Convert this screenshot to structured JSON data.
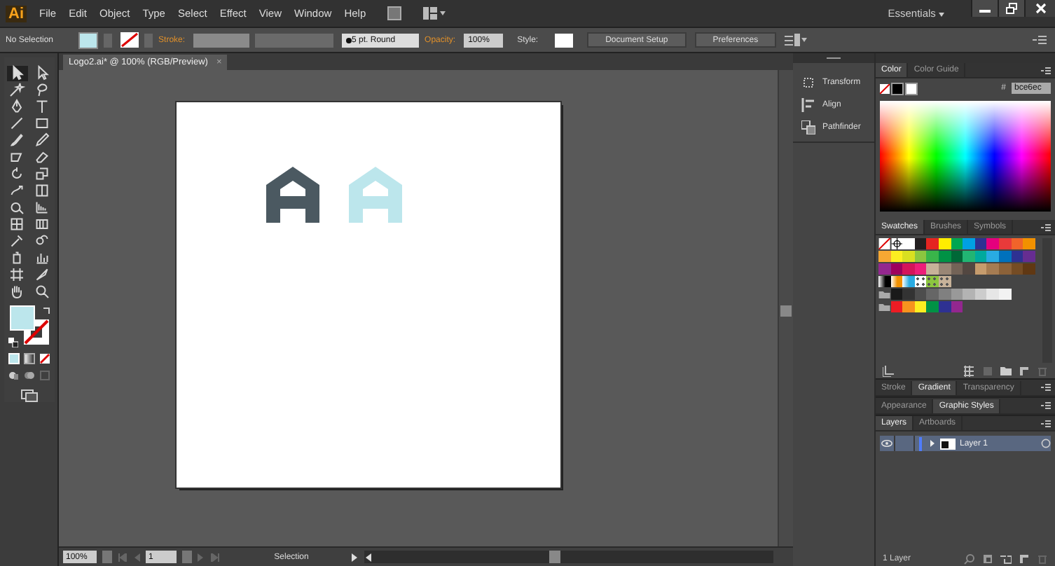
{
  "menu_bar": {
    "logo": "Ai",
    "items": [
      "File",
      "Edit",
      "Object",
      "Type",
      "Select",
      "Effect",
      "View",
      "Window",
      "Help"
    ],
    "workspace": "Essentials"
  },
  "current_colors": {
    "fill": {
      "color": "#bce6ec"
    },
    "stroke": {
      "none": true
    }
  },
  "control_bar": {
    "selection": "No Selection",
    "stroke_label": "Stroke:",
    "brush": "5 pt. Round",
    "opacity_label": "Opacity:",
    "opacity": "100%",
    "style_label": "Style:",
    "buttons": [
      "Document Setup",
      "Preferences"
    ]
  },
  "document_tab": {
    "title": "Logo2.ai* @ 100% (RGB/Preview)",
    "close": "×"
  },
  "tools": [
    {
      "kind": "arrow",
      "selected": true
    },
    {
      "kind": "hollow-arrow",
      "selected": false
    },
    {
      "kind": "wand",
      "selected": false
    },
    {
      "kind": "lasso",
      "selected": false
    },
    {
      "kind": "pen",
      "selected": false
    },
    {
      "kind": "type",
      "selected": false
    },
    {
      "kind": "line",
      "selected": false
    },
    {
      "kind": "rectangle",
      "selected": false
    },
    {
      "kind": "brush",
      "selected": false
    },
    {
      "kind": "pencil",
      "selected": false
    },
    {
      "kind": "blob-brush",
      "selected": false
    },
    {
      "kind": "eraser",
      "selected": false
    },
    {
      "kind": "rotate",
      "selected": false
    },
    {
      "kind": "scale",
      "selected": false
    },
    {
      "kind": "warp",
      "selected": false
    },
    {
      "kind": "free-transform",
      "selected": false
    },
    {
      "kind": "shape-builder",
      "selected": false
    },
    {
      "kind": "perspective-grid",
      "selected": false
    },
    {
      "kind": "mesh",
      "selected": false
    },
    {
      "kind": "gradient",
      "selected": false
    },
    {
      "kind": "eyedropper",
      "selected": false
    },
    {
      "kind": "blend",
      "selected": false
    },
    {
      "kind": "spray-can",
      "selected": false
    },
    {
      "kind": "bar-graph",
      "selected": false
    },
    {
      "kind": "artboard",
      "selected": false
    },
    {
      "kind": "knife",
      "selected": false
    },
    {
      "kind": "hand",
      "selected": false
    },
    {
      "kind": "zoom",
      "selected": false
    }
  ],
  "artwork": [
    {
      "color": "#4b5961"
    },
    {
      "color": "#bce6ec"
    }
  ],
  "status_bar": {
    "zoom": "100%",
    "page": "1",
    "tool": "Selection"
  },
  "side_panels": [
    "Transform",
    "Align",
    "Pathfinder"
  ],
  "color_panel": {
    "tabs": [
      {
        "label": "Color",
        "selected": true
      },
      {
        "label": "Color Guide",
        "selected": false
      }
    ],
    "hash": "#",
    "hex": "bce6ec"
  },
  "swatches_panel": {
    "tabs": [
      {
        "label": "Swatches",
        "selected": true
      },
      {
        "label": "Brushes",
        "selected": false
      },
      {
        "label": "Symbols",
        "selected": false
      }
    ],
    "rows": [
      [
        {
          "kind": "none"
        },
        {
          "kind": "registration"
        },
        {
          "kind": "color",
          "color": "#ffffff"
        },
        {
          "kind": "color",
          "color": "#231f20"
        },
        {
          "kind": "color",
          "color": "#e52421"
        },
        {
          "kind": "color",
          "color": "#ffed00"
        },
        {
          "kind": "color",
          "color": "#00a651"
        },
        {
          "kind": "color",
          "color": "#00a0e3"
        },
        {
          "kind": "color",
          "color": "#2e3192"
        },
        {
          "kind": "color",
          "color": "#e5007d"
        },
        {
          "kind": "color",
          "color": "#e83a3a"
        },
        {
          "kind": "color",
          "color": "#f0642a"
        },
        {
          "kind": "color",
          "color": "#f29100"
        }
      ],
      [
        {
          "kind": "color",
          "color": "#f7a833"
        },
        {
          "kind": "color",
          "color": "#fcee21"
        },
        {
          "kind": "color",
          "color": "#d9e021"
        },
        {
          "kind": "color",
          "color": "#8cc63f"
        },
        {
          "kind": "color",
          "color": "#39b54a"
        },
        {
          "kind": "color",
          "color": "#009245"
        },
        {
          "kind": "color",
          "color": "#006837"
        },
        {
          "kind": "color",
          "color": "#22b573"
        },
        {
          "kind": "color",
          "color": "#00a99d"
        },
        {
          "kind": "color",
          "color": "#29abe2"
        },
        {
          "kind": "color",
          "color": "#0071bc"
        },
        {
          "kind": "color",
          "color": "#2e3192"
        },
        {
          "kind": "color",
          "color": "#662d91"
        }
      ],
      [
        {
          "kind": "color",
          "color": "#93278f"
        },
        {
          "kind": "color",
          "color": "#9e005d"
        },
        {
          "kind": "color",
          "color": "#d4145a"
        },
        {
          "kind": "color",
          "color": "#ed1e79"
        },
        {
          "kind": "color",
          "color": "#c7b299"
        },
        {
          "kind": "color",
          "color": "#998675"
        },
        {
          "kind": "color",
          "color": "#736357"
        },
        {
          "kind": "color",
          "color": "#534741"
        },
        {
          "kind": "color",
          "color": "#c69c6d"
        },
        {
          "kind": "color",
          "color": "#a67c52"
        },
        {
          "kind": "color",
          "color": "#8c6239"
        },
        {
          "kind": "color",
          "color": "#754c24"
        },
        {
          "kind": "color",
          "color": "#603813"
        }
      ],
      [
        {
          "kind": "gradient",
          "color": "#000000"
        },
        {
          "kind": "gradient",
          "color": "#f29100"
        },
        {
          "kind": "gradient",
          "color": "#29abe2"
        },
        {
          "kind": "pattern",
          "color": "#ffffff"
        },
        {
          "kind": "pattern",
          "color": "#8cc63f"
        },
        {
          "kind": "pattern",
          "color": "#c7b299"
        }
      ],
      [
        {
          "kind": "folder"
        },
        {
          "kind": "color",
          "color": "#1a1a1a"
        },
        {
          "kind": "color",
          "color": "#333333"
        },
        {
          "kind": "color",
          "color": "#4d4d4d"
        },
        {
          "kind": "color",
          "color": "#666666"
        },
        {
          "kind": "color",
          "color": "#808080"
        },
        {
          "kind": "color",
          "color": "#999999"
        },
        {
          "kind": "color",
          "color": "#b3b3b3"
        },
        {
          "kind": "color",
          "color": "#cccccc"
        },
        {
          "kind": "color",
          "color": "#e6e6e6"
        },
        {
          "kind": "color",
          "color": "#f2f2f2"
        }
      ],
      [
        {
          "kind": "folder"
        },
        {
          "kind": "color",
          "color": "#ed1c24"
        },
        {
          "kind": "color",
          "color": "#f7931e"
        },
        {
          "kind": "color",
          "color": "#fcee21"
        },
        {
          "kind": "color",
          "color": "#009245"
        },
        {
          "kind": "color",
          "color": "#2e3192"
        },
        {
          "kind": "color",
          "color": "#93278f"
        }
      ]
    ]
  },
  "stroke_tabs": [
    {
      "label": "Stroke",
      "selected": false
    },
    {
      "label": "Gradient",
      "selected": true
    },
    {
      "label": "Transparency",
      "selected": false
    }
  ],
  "appearance_tabs": [
    {
      "label": "Appearance",
      "selected": false
    },
    {
      "label": "Graphic Styles",
      "selected": true
    }
  ],
  "layers_panel": {
    "tabs": [
      {
        "label": "Layers",
        "selected": true
      },
      {
        "label": "Artboards",
        "selected": false
      }
    ],
    "layers": [
      {
        "name": "Layer 1",
        "visible": true,
        "expanded": false,
        "selected": true,
        "color": "#4f7cff"
      }
    ],
    "count": "1 Layer"
  }
}
